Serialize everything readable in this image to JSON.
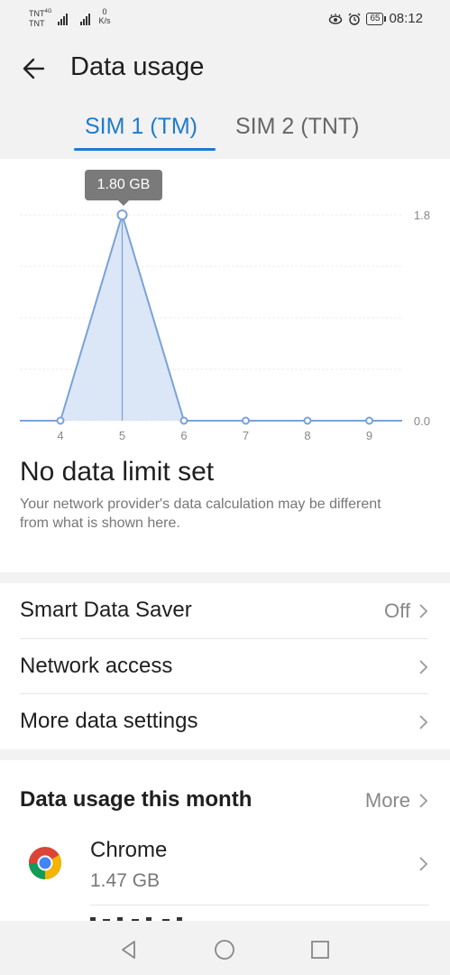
{
  "status_bar": {
    "carrier_top": "TNT",
    "carrier_net": "4G",
    "carrier_bottom": "TNT",
    "speed_value": "0",
    "speed_unit": "K/s",
    "battery": "65",
    "time": "08:12"
  },
  "app_bar": {
    "title": "Data usage"
  },
  "tabs": [
    {
      "label": "SIM 1 (TM)",
      "active": true
    },
    {
      "label": "SIM 2 (TNT)",
      "active": false
    }
  ],
  "chart_data": {
    "type": "area",
    "x": [
      3,
      4,
      5,
      6,
      7,
      8,
      9,
      10
    ],
    "tick_labels": [
      "4",
      "5",
      "6",
      "7",
      "8",
      "9"
    ],
    "series": [
      {
        "values": [
          0,
          0,
          1.8,
          0,
          0,
          0,
          0,
          0
        ]
      }
    ],
    "y_tick_top": "1.8",
    "y_tick_bottom": "0.0",
    "ylim": [
      0,
      1.8
    ],
    "highlight_label": "1.80 GB",
    "line_color": "#7aa2d8",
    "fill_color": "#dbe6f7"
  },
  "data_limit": {
    "title": "No data limit set",
    "disclaimer": "Your network provider's data calculation may be different from what is shown here."
  },
  "settings": [
    {
      "label": "Smart Data Saver",
      "value": "Off"
    },
    {
      "label": "Network access",
      "value": ""
    },
    {
      "label": "More data settings",
      "value": ""
    }
  ],
  "usage_section": {
    "title": "Data usage this month",
    "more_label": "More",
    "apps": [
      {
        "name": "Chrome",
        "size": "1.47 GB",
        "icon": "chrome-icon"
      }
    ]
  },
  "colors": {
    "accent": "#1e7ad1",
    "background": "#f2f2f2"
  }
}
